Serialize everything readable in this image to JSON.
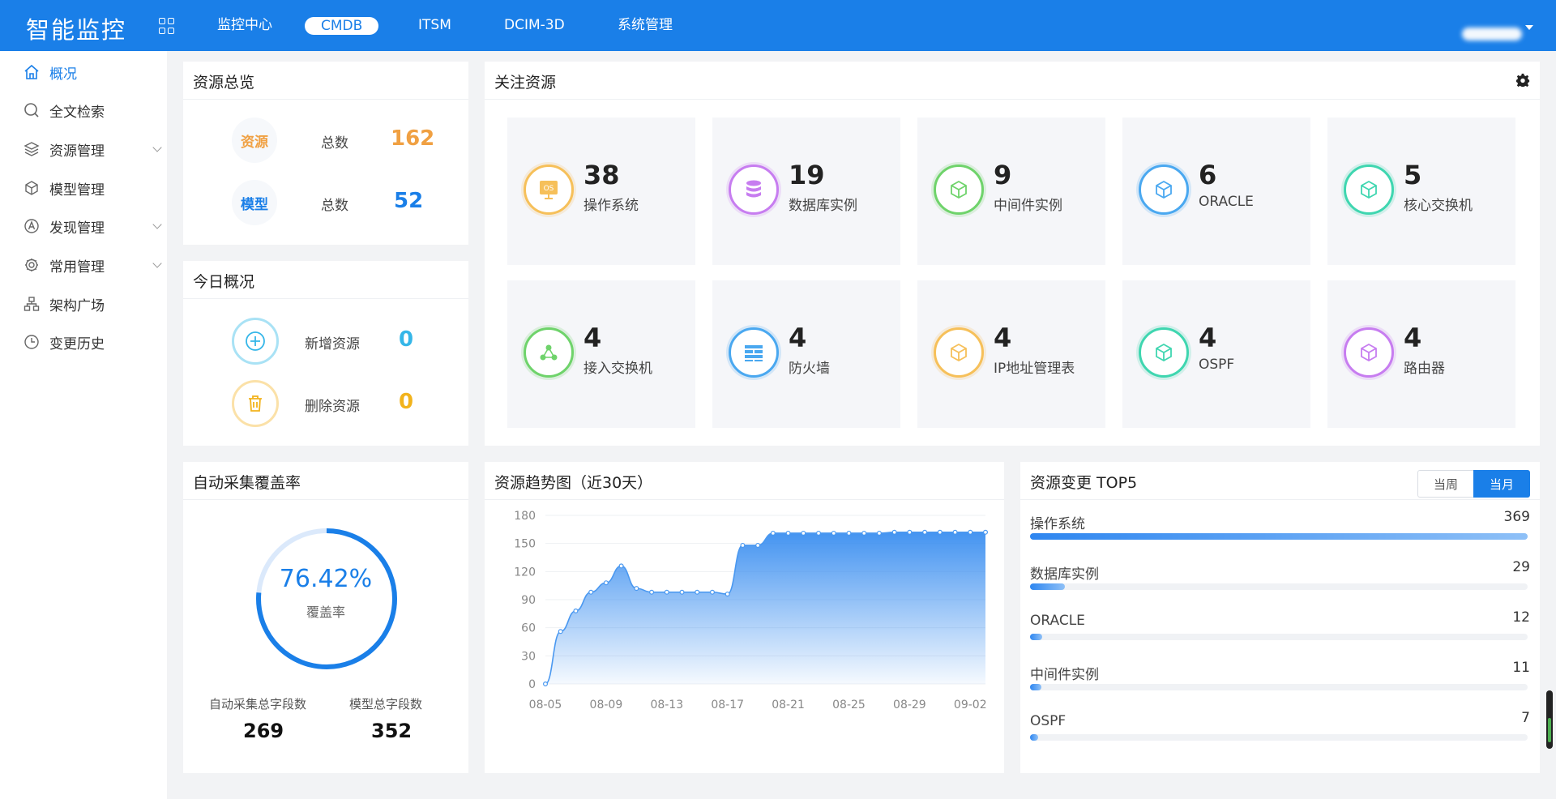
{
  "app": {
    "brand": "智能监控",
    "nav": [
      "监控中心",
      "CMDB",
      "ITSM",
      "DCIM-3D",
      "系统管理"
    ],
    "active_nav": "CMDB"
  },
  "sidebar": {
    "items": [
      {
        "label": "概况",
        "icon": "home-icon",
        "active": true
      },
      {
        "label": "全文检索",
        "icon": "search-icon"
      },
      {
        "label": "资源管理",
        "icon": "layers-icon",
        "expandable": true
      },
      {
        "label": "模型管理",
        "icon": "cube-icon"
      },
      {
        "label": "发现管理",
        "icon": "discover-icon",
        "expandable": true
      },
      {
        "label": "常用管理",
        "icon": "gear-icon",
        "expandable": true
      },
      {
        "label": "架构广场",
        "icon": "org-chart-icon"
      },
      {
        "label": "变更历史",
        "icon": "clock-icon"
      }
    ]
  },
  "overview": {
    "title": "资源总览",
    "rows": [
      {
        "badge": "资源",
        "label": "总数",
        "value": "162",
        "color": "#f0a042"
      },
      {
        "badge": "模型",
        "label": "总数",
        "value": "52",
        "color": "#1a7fe8"
      }
    ]
  },
  "today": {
    "title": "今日概况",
    "rows": [
      {
        "label": "新增资源",
        "value": "0",
        "color": "#35b6e8",
        "icon": "plus-circle-icon"
      },
      {
        "label": "删除资源",
        "value": "0",
        "color": "#f2b31c",
        "icon": "trash-icon"
      }
    ]
  },
  "focus": {
    "title": "关注资源",
    "cards": [
      {
        "value": "38",
        "name": "操作系统",
        "color": "#f6c05a",
        "icon": "os-icon"
      },
      {
        "value": "19",
        "name": "数据库实例",
        "color": "#c77df0",
        "icon": "database-icon"
      },
      {
        "value": "9",
        "name": "中间件实例",
        "color": "#6fd36b",
        "icon": "cube-icon"
      },
      {
        "value": "6",
        "name": "ORACLE",
        "color": "#4aa8f0",
        "icon": "cube-icon"
      },
      {
        "value": "5",
        "name": "核心交换机",
        "color": "#3fd6b0",
        "icon": "cube-icon"
      },
      {
        "value": "4",
        "name": "接入交换机",
        "color": "#6fd36b",
        "icon": "share-icon"
      },
      {
        "value": "4",
        "name": "防火墙",
        "color": "#4aa8f0",
        "icon": "firewall-icon"
      },
      {
        "value": "4",
        "name": "IP地址管理表",
        "color": "#f6c05a",
        "icon": "cube-icon"
      },
      {
        "value": "4",
        "name": "OSPF",
        "color": "#3fd6b0",
        "icon": "cube-icon"
      },
      {
        "value": "4",
        "name": "路由器",
        "color": "#c77df0",
        "icon": "cube-icon"
      }
    ]
  },
  "coverage": {
    "title": "自动采集覆盖率",
    "percent_text": "76.42%",
    "percent": 76.42,
    "caption": "覆盖率",
    "left_label": "自动采集总字段数",
    "left_value": "269",
    "right_label": "模型总字段数",
    "right_value": "352"
  },
  "trend": {
    "title": "资源趋势图（近30天）"
  },
  "chart_data": {
    "type": "area",
    "title": "资源趋势图（近30天）",
    "x": [
      "08-05",
      "08-06",
      "08-07",
      "08-08",
      "08-09",
      "08-10",
      "08-11",
      "08-12",
      "08-13",
      "08-14",
      "08-15",
      "08-16",
      "08-17",
      "08-18",
      "08-19",
      "08-20",
      "08-21",
      "08-22",
      "08-23",
      "08-24",
      "08-25",
      "08-26",
      "08-27",
      "08-28",
      "08-29",
      "08-30",
      "08-31",
      "09-01",
      "09-02",
      "09-03"
    ],
    "values": [
      0,
      56,
      78,
      98,
      108,
      126,
      102,
      98,
      98,
      98,
      98,
      98,
      96,
      148,
      148,
      161,
      161,
      161,
      161,
      161,
      161,
      161,
      161,
      162,
      162,
      162,
      162,
      162,
      162,
      162
    ],
    "xticks": [
      "08-05",
      "08-09",
      "08-13",
      "08-17",
      "08-21",
      "08-25",
      "08-29",
      "09-02"
    ],
    "yticks": [
      0,
      30,
      60,
      90,
      120,
      150,
      180
    ],
    "ylim": [
      0,
      180
    ]
  },
  "top5": {
    "title": "资源变更 TOP5",
    "toggle_week": "当周",
    "toggle_month": "当月",
    "items": [
      {
        "name": "操作系统",
        "value": "369",
        "ratio": 1.0
      },
      {
        "name": "数据库实例",
        "value": "29",
        "ratio": 0.07
      },
      {
        "name": "ORACLE",
        "value": "12",
        "ratio": 0.025
      },
      {
        "name": "中间件实例",
        "value": "11",
        "ratio": 0.022
      },
      {
        "name": "OSPF",
        "value": "7",
        "ratio": 0.012
      }
    ]
  }
}
